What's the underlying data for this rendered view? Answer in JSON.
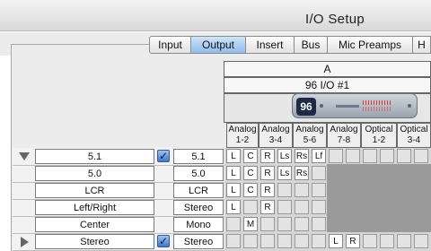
{
  "window": {
    "title": "I/O Setup"
  },
  "tabs": [
    {
      "label": "Input",
      "active": false
    },
    {
      "label": "Output",
      "active": true
    },
    {
      "label": "Insert",
      "active": false
    },
    {
      "label": "Bus",
      "active": false
    },
    {
      "label": "Mic Preamps",
      "active": false
    },
    {
      "label": "H",
      "active": false
    }
  ],
  "interface": {
    "group_label": "A",
    "device_label": "96 I/O #1",
    "device_badge": "96"
  },
  "channel_headers": [
    {
      "top": "Analog",
      "bottom": "1-2"
    },
    {
      "top": "Analog",
      "bottom": "3-4"
    },
    {
      "top": "Analog",
      "bottom": "5-6"
    },
    {
      "top": "Analog",
      "bottom": "7-8"
    },
    {
      "top": "Optical",
      "bottom": "1-2"
    },
    {
      "top": "Optical",
      "bottom": "3-4"
    }
  ],
  "paths": [
    {
      "name": "5.1",
      "format": "5.1",
      "expand": "down",
      "checked": true,
      "cells": [
        "L",
        "C",
        "R",
        "Ls",
        "Rs",
        "Lf"
      ],
      "offset": 0
    },
    {
      "name": "5.0",
      "format": "5.0",
      "expand": "",
      "checked": false,
      "cells": [
        "L",
        "C",
        "R",
        "Ls",
        "Rs"
      ],
      "offset": 0
    },
    {
      "name": "LCR",
      "format": "LCR",
      "expand": "",
      "checked": false,
      "cells": [
        "L",
        "C",
        "R"
      ],
      "offset": 0
    },
    {
      "name": "Left/Right",
      "format": "Stereo",
      "expand": "",
      "checked": false,
      "cells": [
        "L",
        "",
        "R"
      ],
      "offset": 0
    },
    {
      "name": "Center",
      "format": "Mono",
      "expand": "",
      "checked": false,
      "cells": [
        "",
        "M"
      ],
      "offset": 0
    },
    {
      "name": "Stereo",
      "format": "Stereo",
      "expand": "right",
      "checked": true,
      "cells": [
        "L",
        "R"
      ],
      "offset": 6
    }
  ],
  "colors": {
    "active_tab": "#8fbcec",
    "checkbox": "#3d79c8",
    "device_badge": "#1f2a46",
    "meter": "#e23838"
  }
}
